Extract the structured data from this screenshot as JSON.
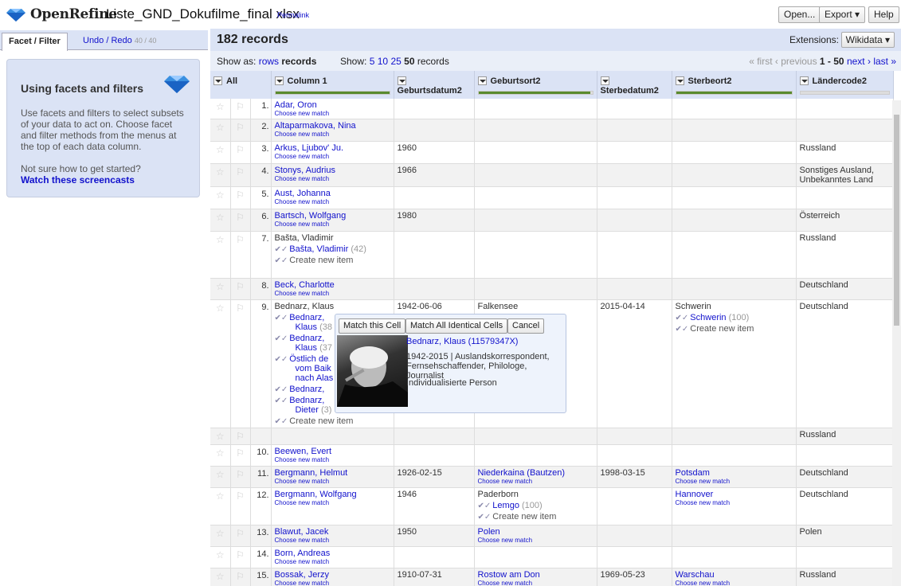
{
  "header": {
    "app_name": "OpenRefine",
    "project_name": "Liste_GND_Dokufilme_final xlsx",
    "permalink": "Permalink",
    "open_button": "Open...",
    "export_button": "Export ▾",
    "help_button": "Help"
  },
  "left_panel": {
    "tabs": {
      "facet_filter": "Facet / Filter",
      "undo_redo": "Undo / Redo",
      "undo_count": "40 / 40"
    },
    "help": {
      "title": "Using facets and filters",
      "body": "Use facets and filters to select subsets of your data to act on. Choose facet and filter methods from the menus at the top of each data column.",
      "question": "Not sure how to get started?",
      "link": "Watch these screencasts"
    }
  },
  "summary": {
    "records_count": "182 records",
    "extensions_label": "Extensions:",
    "extensions_button": "Wikidata ▾"
  },
  "controls": {
    "show_as_label": "Show as:",
    "rows": "rows",
    "records": "records",
    "show_label": "Show:",
    "show_options": [
      "5",
      "10",
      "25",
      "50"
    ],
    "show_suffix": "records",
    "pager": {
      "first": "« first",
      "previous": "‹ previous",
      "range": "1 - 50",
      "next": "next ›",
      "last": "last »"
    }
  },
  "columns": {
    "all": "All",
    "col1": "Column 1",
    "geburtsdatum": "Geburtsdatum2",
    "geburtsort": "Geburtsort2",
    "sterbedatum": "Sterbedatum2",
    "sterbeort": "Sterbeort2",
    "laendercode": "Ländercode2"
  },
  "column_fill": {
    "col1": 1.0,
    "geburtsort": 0.98,
    "sterbeort": 1.0,
    "laendercode": 0.0
  },
  "labels": {
    "choose_new_match": "Choose new match",
    "create_new_item": "Create new item"
  },
  "rows": [
    {
      "num": "1.",
      "name": "Adar, Oron",
      "country": ""
    },
    {
      "num": "2.",
      "name": "Altaparmakova, Nina",
      "country": ""
    },
    {
      "num": "3.",
      "name": "Arkus, Ljubov' Ju.",
      "birth": "1960",
      "country": "Russland"
    },
    {
      "num": "4.",
      "name": "Stonys, Audrius",
      "birth": "1966",
      "country": "Sonstiges Ausland, Unbekanntes Land"
    },
    {
      "num": "5.",
      "name": "Aust, Johanna",
      "country": ""
    },
    {
      "num": "6.",
      "name": "Bartsch, Wolfgang",
      "birth": "1980",
      "country": "Österreich"
    },
    {
      "num": "7.",
      "name": "Bašta, Vladimir",
      "cand1": "Bašta, Vladimir",
      "cand1_score": "(42)",
      "country": "Russland"
    },
    {
      "num": "8.",
      "name": "Beck, Charlotte",
      "country": "Deutschland"
    },
    {
      "num": "9.",
      "name": "Bednarz, Klaus",
      "birth": "1942-06-06",
      "birthplace": "Falkensee",
      "death": "2015-04-14",
      "deathplace": "Schwerin",
      "deathplace_cand": "Schwerin",
      "deathplace_score": "(100)",
      "country": "Deutschland",
      "cands": [
        {
          "a": "Bednarz,",
          "b": "Klaus",
          "s": "(38"
        },
        {
          "a": "Bednarz,",
          "b": "Klaus",
          "s": "(37"
        },
        {
          "a": "Östlich de",
          "b": "vom Baik",
          "c": "nach Alas"
        },
        {
          "a": "Bednarz,",
          "b": ""
        },
        {
          "a": "Bednarz,",
          "b": "Dieter",
          "s": "(3)"
        }
      ]
    },
    {
      "num": "",
      "name": "",
      "country": "Russland"
    },
    {
      "num": "10.",
      "name": "Beewen, Evert",
      "country": ""
    },
    {
      "num": "11.",
      "name": "Bergmann, Helmut",
      "birth": "1926-02-15",
      "birthplace": "Niederkaina (Bautzen)",
      "death": "1998-03-15",
      "deathplace": "Potsdam",
      "country": "Deutschland"
    },
    {
      "num": "12.",
      "name": "Bergmann, Wolfgang",
      "birth": "1946",
      "birthplace": "Paderborn",
      "birthplace_cand": "Lemgo",
      "birthplace_score": "(100)",
      "deathplace": "Hannover",
      "country": "Deutschland"
    },
    {
      "num": "13.",
      "name": "Blawut, Jacek",
      "birth": "1950",
      "birthplace": "Polen",
      "country": "Polen"
    },
    {
      "num": "14.",
      "name": "Born, Andreas",
      "country": ""
    },
    {
      "num": "15.",
      "name": "Bossak, Jerzy",
      "birth": "1910-07-31",
      "birthplace": "Rostow am Don",
      "death": "1969-05-23",
      "deathplace": "Warschau",
      "country": "Russland"
    }
  ],
  "popup": {
    "match_cell": "Match this Cell",
    "match_all": "Match All Identical Cells",
    "cancel": "Cancel",
    "name": "Bednarz, Klaus (11579347X)",
    "desc": "1942-2015 | Auslandskorrespondent, Fernsehschaffender, Philologe, Journalist",
    "type": "Individualisierte Person"
  }
}
